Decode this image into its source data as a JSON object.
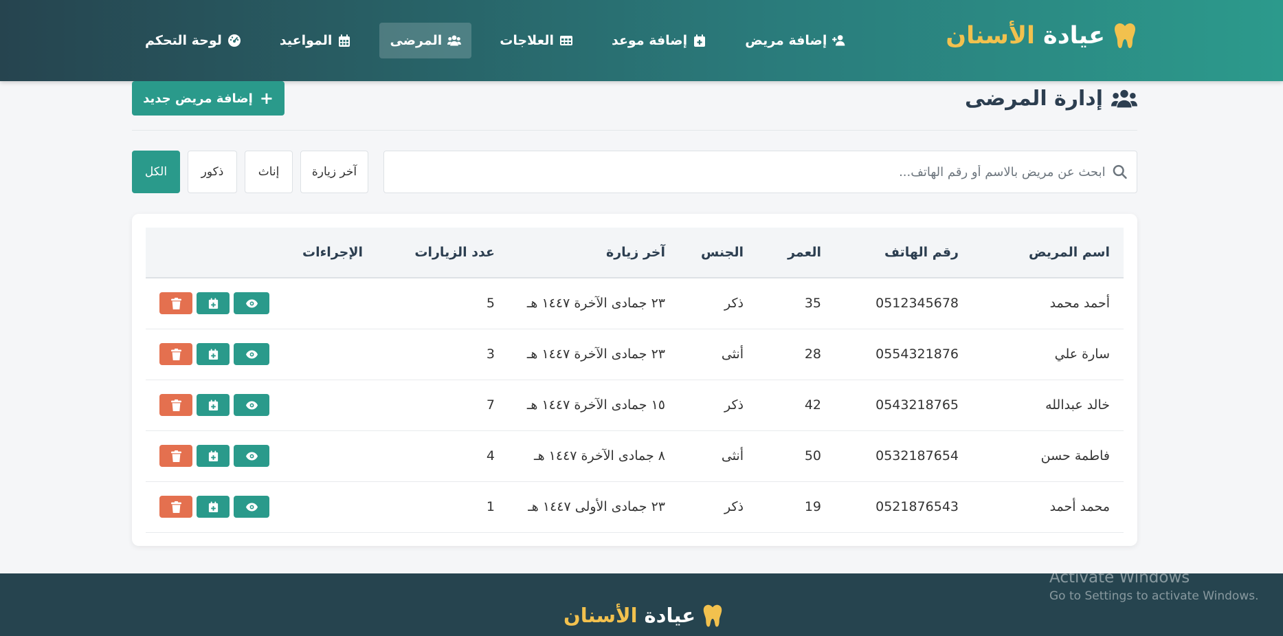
{
  "brand": {
    "part1": "عيادة",
    "part2": "الأسنان"
  },
  "nav": {
    "items": [
      {
        "label": "لوحة التحكم",
        "icon": "gauge-icon"
      },
      {
        "label": "المواعيد",
        "icon": "calendar-icon"
      },
      {
        "label": "المرضى",
        "icon": "users-icon",
        "active": true
      },
      {
        "label": "العلاجات",
        "icon": "grid-table-icon"
      },
      {
        "label": "إضافة موعد",
        "icon": "calendar-plus-icon"
      },
      {
        "label": "إضافة مريض",
        "icon": "user-plus-icon"
      }
    ]
  },
  "page": {
    "title": "إدارة المرضى",
    "add_button_label": "إضافة مريض جديد"
  },
  "search": {
    "placeholder": "ابحث عن مريض بالاسم أو رقم الهاتف...",
    "value": ""
  },
  "filters": [
    {
      "label": "الكل",
      "active": true
    },
    {
      "label": "ذكور"
    },
    {
      "label": "إناث"
    },
    {
      "label": "آخر زيارة"
    }
  ],
  "table": {
    "headers": [
      "اسم المريض",
      "رقم الهاتف",
      "العمر",
      "الجنس",
      "آخر زيارة",
      "عدد الزيارات",
      "الإجراءات"
    ],
    "rows": [
      {
        "name": "أحمد محمد",
        "phone": "0512345678",
        "age": "35",
        "gender": "ذكر",
        "last_visit": "٢٣ جمادى الآخرة ١٤٤٧ هـ",
        "visits": "5"
      },
      {
        "name": "سارة علي",
        "phone": "0554321876",
        "age": "28",
        "gender": "أنثى",
        "last_visit": "٢٣ جمادى الآخرة ١٤٤٧ هـ",
        "visits": "3"
      },
      {
        "name": "خالد عبدالله",
        "phone": "0543218765",
        "age": "42",
        "gender": "ذكر",
        "last_visit": "١٥ جمادى الآخرة ١٤٤٧ هـ",
        "visits": "7"
      },
      {
        "name": "فاطمة حسن",
        "phone": "0532187654",
        "age": "50",
        "gender": "أنثى",
        "last_visit": "٨ جمادى الآخرة ١٤٤٧ هـ",
        "visits": "4"
      },
      {
        "name": "محمد أحمد",
        "phone": "0521876543",
        "age": "19",
        "gender": "ذكر",
        "last_visit": "٢٣ جمادى الأولى ١٤٤٧ هـ",
        "visits": "1"
      }
    ]
  },
  "footer": {
    "part1": "عيادة",
    "part2": "الأسنان"
  },
  "watermark": {
    "line1": "Activate Windows",
    "line2": "Go to Settings to activate Windows."
  },
  "colors": {
    "primary": "#2a9a8b",
    "navbar_dark": "#26444f",
    "accent": "#f2c14e",
    "danger": "#e4704f"
  }
}
